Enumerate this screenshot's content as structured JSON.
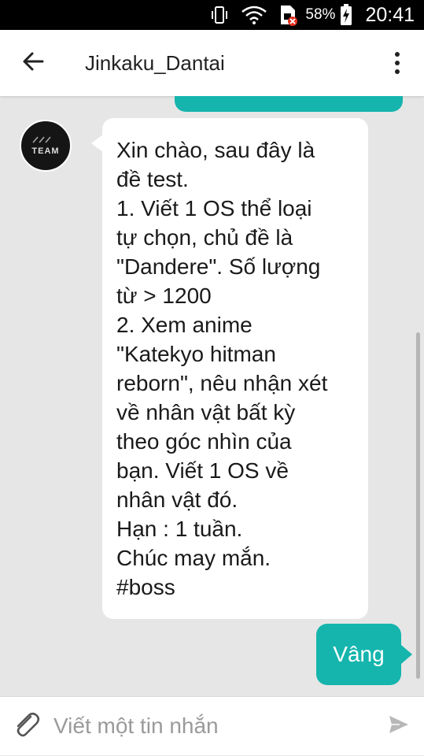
{
  "status_bar": {
    "battery_percent": "58%",
    "time": "20:41"
  },
  "header": {
    "title": "Jinkaku_Dantai"
  },
  "chat": {
    "incoming_avatar_text": "TEAM",
    "incoming_message": "Xin chào, sau đây là\nđề test.\n1. Viết 1 OS thể loại\ntự chọn, chủ đề là\n\"Dandere\". Số lượng\ntừ > 1200\n2. Xem anime\n\"Katekyo hitman\nreborn\", nêu nhận xét\nvề nhân vật bất kỳ\ntheo góc nhìn của\nbạn. Viết 1 OS về\nnhân vật đó.\nHạn : 1 tuần.\nChúc may mắn.\n#boss",
    "outgoing_message": "Vâng"
  },
  "composer": {
    "placeholder": "Viết một tin nhắn"
  },
  "colors": {
    "accent": "#15b5ad",
    "chat_background": "#e6e6e6",
    "bubble_incoming": "#ffffff"
  }
}
